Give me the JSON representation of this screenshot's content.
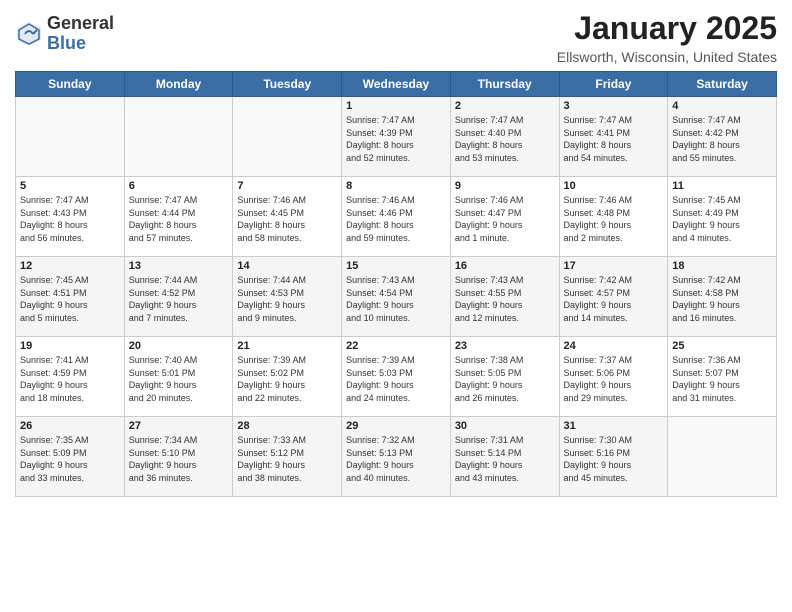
{
  "header": {
    "logo_general": "General",
    "logo_blue": "Blue",
    "title": "January 2025",
    "subtitle": "Ellsworth, Wisconsin, United States"
  },
  "weekdays": [
    "Sunday",
    "Monday",
    "Tuesday",
    "Wednesday",
    "Thursday",
    "Friday",
    "Saturday"
  ],
  "weeks": [
    [
      {
        "day": "",
        "info": ""
      },
      {
        "day": "",
        "info": ""
      },
      {
        "day": "",
        "info": ""
      },
      {
        "day": "1",
        "info": "Sunrise: 7:47 AM\nSunset: 4:39 PM\nDaylight: 8 hours\nand 52 minutes."
      },
      {
        "day": "2",
        "info": "Sunrise: 7:47 AM\nSunset: 4:40 PM\nDaylight: 8 hours\nand 53 minutes."
      },
      {
        "day": "3",
        "info": "Sunrise: 7:47 AM\nSunset: 4:41 PM\nDaylight: 8 hours\nand 54 minutes."
      },
      {
        "day": "4",
        "info": "Sunrise: 7:47 AM\nSunset: 4:42 PM\nDaylight: 8 hours\nand 55 minutes."
      }
    ],
    [
      {
        "day": "5",
        "info": "Sunrise: 7:47 AM\nSunset: 4:43 PM\nDaylight: 8 hours\nand 56 minutes."
      },
      {
        "day": "6",
        "info": "Sunrise: 7:47 AM\nSunset: 4:44 PM\nDaylight: 8 hours\nand 57 minutes."
      },
      {
        "day": "7",
        "info": "Sunrise: 7:46 AM\nSunset: 4:45 PM\nDaylight: 8 hours\nand 58 minutes."
      },
      {
        "day": "8",
        "info": "Sunrise: 7:46 AM\nSunset: 4:46 PM\nDaylight: 8 hours\nand 59 minutes."
      },
      {
        "day": "9",
        "info": "Sunrise: 7:46 AM\nSunset: 4:47 PM\nDaylight: 9 hours\nand 1 minute."
      },
      {
        "day": "10",
        "info": "Sunrise: 7:46 AM\nSunset: 4:48 PM\nDaylight: 9 hours\nand 2 minutes."
      },
      {
        "day": "11",
        "info": "Sunrise: 7:45 AM\nSunset: 4:49 PM\nDaylight: 9 hours\nand 4 minutes."
      }
    ],
    [
      {
        "day": "12",
        "info": "Sunrise: 7:45 AM\nSunset: 4:51 PM\nDaylight: 9 hours\nand 5 minutes."
      },
      {
        "day": "13",
        "info": "Sunrise: 7:44 AM\nSunset: 4:52 PM\nDaylight: 9 hours\nand 7 minutes."
      },
      {
        "day": "14",
        "info": "Sunrise: 7:44 AM\nSunset: 4:53 PM\nDaylight: 9 hours\nand 9 minutes."
      },
      {
        "day": "15",
        "info": "Sunrise: 7:43 AM\nSunset: 4:54 PM\nDaylight: 9 hours\nand 10 minutes."
      },
      {
        "day": "16",
        "info": "Sunrise: 7:43 AM\nSunset: 4:55 PM\nDaylight: 9 hours\nand 12 minutes."
      },
      {
        "day": "17",
        "info": "Sunrise: 7:42 AM\nSunset: 4:57 PM\nDaylight: 9 hours\nand 14 minutes."
      },
      {
        "day": "18",
        "info": "Sunrise: 7:42 AM\nSunset: 4:58 PM\nDaylight: 9 hours\nand 16 minutes."
      }
    ],
    [
      {
        "day": "19",
        "info": "Sunrise: 7:41 AM\nSunset: 4:59 PM\nDaylight: 9 hours\nand 18 minutes."
      },
      {
        "day": "20",
        "info": "Sunrise: 7:40 AM\nSunset: 5:01 PM\nDaylight: 9 hours\nand 20 minutes."
      },
      {
        "day": "21",
        "info": "Sunrise: 7:39 AM\nSunset: 5:02 PM\nDaylight: 9 hours\nand 22 minutes."
      },
      {
        "day": "22",
        "info": "Sunrise: 7:39 AM\nSunset: 5:03 PM\nDaylight: 9 hours\nand 24 minutes."
      },
      {
        "day": "23",
        "info": "Sunrise: 7:38 AM\nSunset: 5:05 PM\nDaylight: 9 hours\nand 26 minutes."
      },
      {
        "day": "24",
        "info": "Sunrise: 7:37 AM\nSunset: 5:06 PM\nDaylight: 9 hours\nand 29 minutes."
      },
      {
        "day": "25",
        "info": "Sunrise: 7:36 AM\nSunset: 5:07 PM\nDaylight: 9 hours\nand 31 minutes."
      }
    ],
    [
      {
        "day": "26",
        "info": "Sunrise: 7:35 AM\nSunset: 5:09 PM\nDaylight: 9 hours\nand 33 minutes."
      },
      {
        "day": "27",
        "info": "Sunrise: 7:34 AM\nSunset: 5:10 PM\nDaylight: 9 hours\nand 36 minutes."
      },
      {
        "day": "28",
        "info": "Sunrise: 7:33 AM\nSunset: 5:12 PM\nDaylight: 9 hours\nand 38 minutes."
      },
      {
        "day": "29",
        "info": "Sunrise: 7:32 AM\nSunset: 5:13 PM\nDaylight: 9 hours\nand 40 minutes."
      },
      {
        "day": "30",
        "info": "Sunrise: 7:31 AM\nSunset: 5:14 PM\nDaylight: 9 hours\nand 43 minutes."
      },
      {
        "day": "31",
        "info": "Sunrise: 7:30 AM\nSunset: 5:16 PM\nDaylight: 9 hours\nand 45 minutes."
      },
      {
        "day": "",
        "info": ""
      }
    ]
  ]
}
